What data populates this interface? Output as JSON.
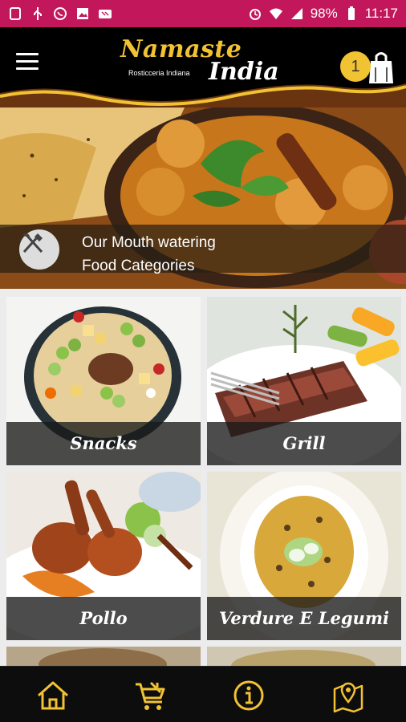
{
  "status_bar": {
    "battery": "98%",
    "time": "11:17",
    "left_icons": [
      "notification-icon",
      "usb-icon",
      "whatsapp-icon",
      "image-icon",
      "tv-icon"
    ],
    "right_icons": [
      "alarm-icon",
      "wifi-icon",
      "signal-icon",
      "battery-icon"
    ]
  },
  "header": {
    "logo_main": "Namaste",
    "logo_second": "India",
    "logo_sub": "Rosticceria Indiana",
    "cart_count": "1"
  },
  "hero": {
    "line1": "Our Mouth watering",
    "line2": "Food Categories"
  },
  "categories": [
    {
      "label": "Snacks"
    },
    {
      "label": "Grill"
    },
    {
      "label": "Pollo"
    },
    {
      "label": "Verdure E Legumi"
    }
  ],
  "bottom_nav": [
    "home-icon",
    "cart-icon",
    "info-icon",
    "map-icon"
  ],
  "colors": {
    "status_bar": "#c2185b",
    "accent_gold": "#f1c232",
    "header_bg": "#000000"
  }
}
